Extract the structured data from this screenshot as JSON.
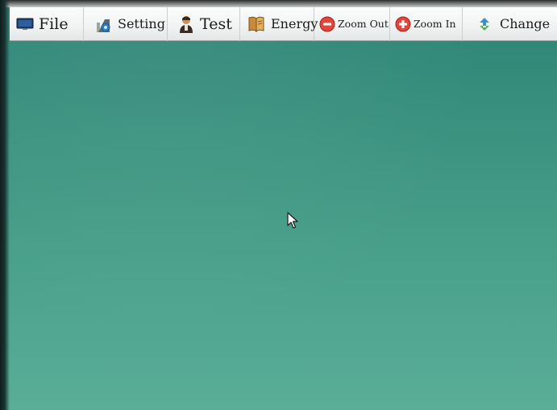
{
  "toolbar": {
    "items": [
      {
        "label": "File",
        "icon": "monitor-icon"
      },
      {
        "label": "Setting",
        "icon": "setting-icon"
      },
      {
        "label": "Test",
        "icon": "person-icon"
      },
      {
        "label": "Energy",
        "icon": "energy-book-icon"
      },
      {
        "label": "Zoom Out",
        "icon": "zoom-out-icon"
      },
      {
        "label": "Zoom In",
        "icon": "zoom-in-icon"
      },
      {
        "label": "Change",
        "icon": "change-icon"
      }
    ]
  },
  "colors": {
    "desktop_top": "#2c8375",
    "desktop_bottom": "#5aae98",
    "toolbar_bg": "#f1f3f3",
    "zoom_red": "#e2453c"
  },
  "cursor": {
    "icon": "arrow-cursor-icon"
  }
}
